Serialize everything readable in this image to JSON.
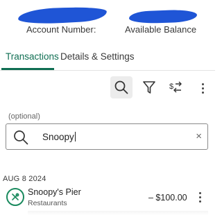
{
  "header": {
    "account_number_label": "Account Number:",
    "available_balance_label": "Available Balance",
    "redaction_color": "#1f55d6"
  },
  "tabs": [
    {
      "label": "Transactions",
      "active": true
    },
    {
      "label": "Details & Settings",
      "active": false
    }
  ],
  "toolbar": {
    "icons": [
      "search-icon",
      "filter-icon",
      "sort-icon",
      "more-vertical-icon"
    ]
  },
  "search": {
    "hint": "(optional)",
    "value": "Snoopy",
    "clear_glyph": "×"
  },
  "transactions": {
    "date_header": "AUG 8 2024",
    "items": [
      {
        "merchant": "Snoopy's Pier",
        "category": "Restaurants",
        "amount": "– $100.00",
        "icon": "restaurant-icon"
      }
    ]
  },
  "colors": {
    "accent": "#0f6e52",
    "icon_green": "#1a8a5e",
    "text": "#3a3a3a"
  }
}
